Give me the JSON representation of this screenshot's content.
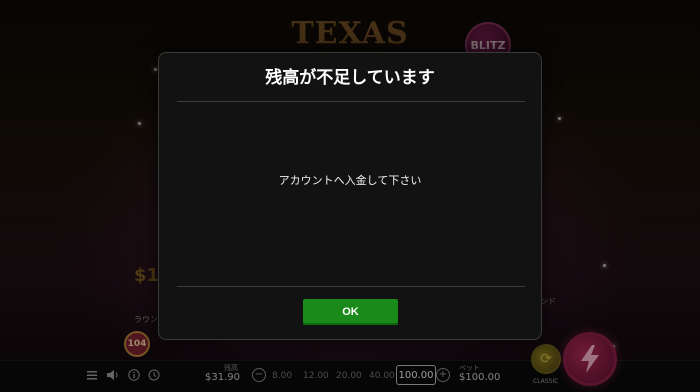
{
  "game": {
    "title": "TEXAS WILD",
    "blitz_badge": "BLITZ",
    "bg_amount": "$1,",
    "round_label": "ラウン",
    "round_value": "104",
    "right_label": "ンド"
  },
  "modal": {
    "title": "残高が不足しています",
    "message": "アカウントへ入金して下さい",
    "ok_label": "OK"
  },
  "controls": {
    "menu_icon": "menu-icon",
    "sound_icon": "speaker-icon",
    "info_icon": "info-icon",
    "history_icon": "history-icon",
    "balance_label": "残高",
    "balance_value": "$31.90",
    "bet_options": [
      "8.00",
      "12.00",
      "20.00",
      "40.00"
    ],
    "bet_selected": "100.00",
    "bet_label": "ベット",
    "bet_value": "$100.00",
    "classic_label": "CLASSIC",
    "spin_icon": "lightning-icon"
  },
  "colors": {
    "ok_button": "#1a8a1a",
    "modal_bg": "#121212",
    "spin_button": "#b02a56"
  }
}
